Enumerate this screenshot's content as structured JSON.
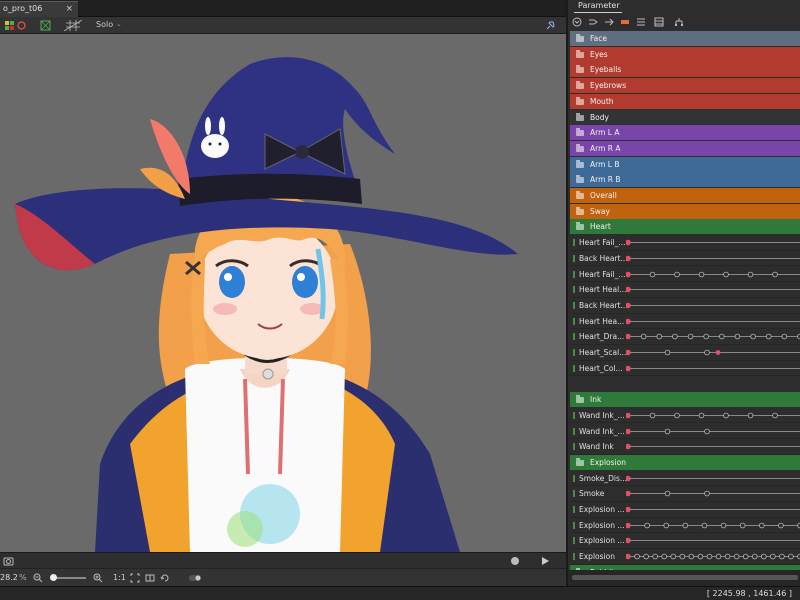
{
  "document_tab": {
    "title": "o_pro_t06",
    "close": "×"
  },
  "toolbar": {
    "solo_label": "Solo",
    "solo_chevron": "⌄"
  },
  "viewport": {
    "zoom_value": "28.2",
    "zoom_unit": "%",
    "ratio_label": "1:1"
  },
  "status": {
    "coordinates": "[ 2245.98 , 1461.46 ]"
  },
  "panel": {
    "title": "Parameter",
    "groups": [
      {
        "label": "Face",
        "color": "#5f6f80",
        "row": 0
      },
      {
        "label": "Eyes",
        "color": "#b23b30",
        "row": 1
      },
      {
        "label": "Eyeballs",
        "color": "#b23b30",
        "row": 2
      },
      {
        "label": "Eyebrows",
        "color": "#b23b30",
        "row": 3
      },
      {
        "label": "Mouth",
        "color": "#b23b30",
        "row": 4
      },
      {
        "label": "Body",
        "color": "#333333",
        "row": 5
      },
      {
        "label": "Arm L A",
        "color": "#7a45a8",
        "row": 6
      },
      {
        "label": "Arm R A",
        "color": "#7a45a8",
        "row": 7
      },
      {
        "label": "Arm L B",
        "color": "#3f6a98",
        "row": 8
      },
      {
        "label": "Arm R B",
        "color": "#3f6a98",
        "row": 9
      },
      {
        "label": "Overall",
        "color": "#c0620e",
        "row": 10
      },
      {
        "label": "Sway",
        "color": "#c0620e",
        "row": 11
      },
      {
        "label": "Heart",
        "color": "#2f7a3a",
        "row": 12
      },
      {
        "label": "Ink",
        "color": "#2f7a3a",
        "row": 23
      },
      {
        "label": "Explosion",
        "color": "#2f7a3a",
        "row": 27
      },
      {
        "label": "Rabbit",
        "color": "#2f7a3a",
        "row": 34
      }
    ],
    "params": [
      {
        "label": "Heart Fail_...",
        "row": 13,
        "keys": 1
      },
      {
        "label": "Back Heart...",
        "row": 14,
        "keys": 1
      },
      {
        "label": "Heart Fail_...",
        "row": 15,
        "keys": 7
      },
      {
        "label": "Heart Heal...",
        "row": 16,
        "keys": 1
      },
      {
        "label": "Back Heart...",
        "row": 17,
        "keys": 1
      },
      {
        "label": "Heart Hea...",
        "row": 18,
        "keys": 1
      },
      {
        "label": "Heart_Dra...",
        "row": 19,
        "keys": 12
      },
      {
        "label": "Heart_Scal...",
        "row": 20,
        "keys": 3
      },
      {
        "label": "Heart_Col...",
        "row": 21,
        "keys": 1
      },
      {
        "label": "Wand Ink_...",
        "row": 24,
        "keys": 7
      },
      {
        "label": "Wand Ink_...",
        "row": 25,
        "keys": 3
      },
      {
        "label": "Wand Ink",
        "row": 26,
        "keys": 1
      },
      {
        "label": "Smoke_Dis...",
        "row": 28,
        "keys": 1
      },
      {
        "label": "Smoke",
        "row": 29,
        "keys": 3
      },
      {
        "label": "Explosion ...",
        "row": 30,
        "keys": 1
      },
      {
        "label": "Explosion ...",
        "row": 31,
        "keys": 10
      },
      {
        "label": "Explosion ...",
        "row": 32,
        "keys": 1
      },
      {
        "label": "Explosion",
        "row": 33,
        "keys": 20
      }
    ]
  }
}
